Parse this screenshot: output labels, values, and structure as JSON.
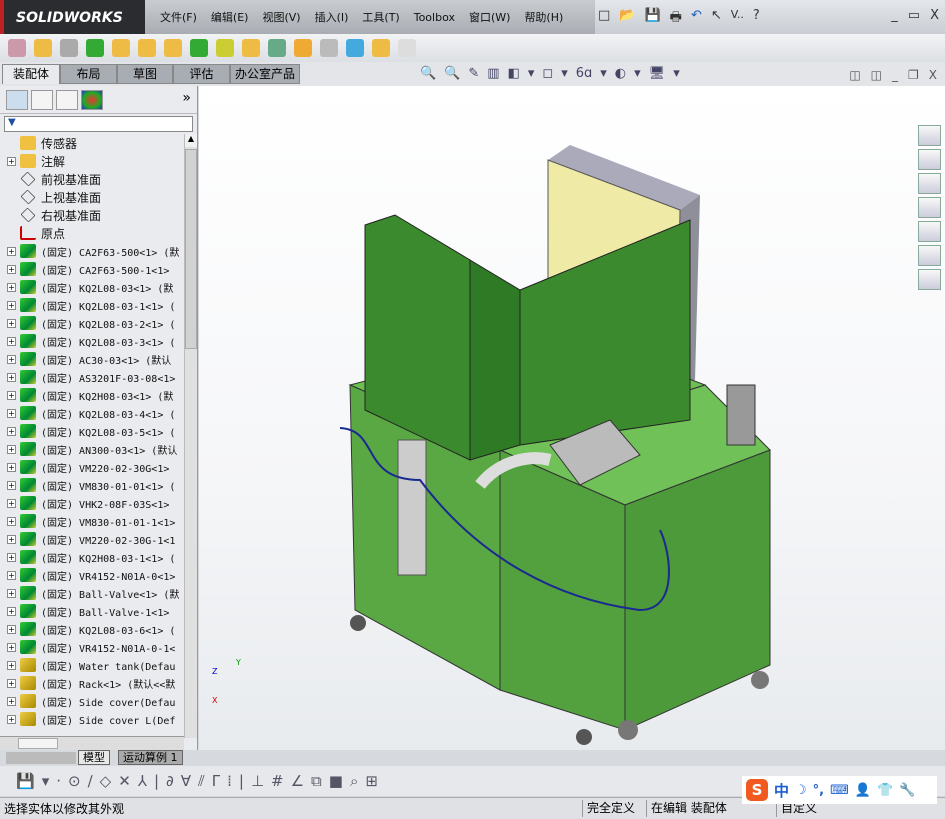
{
  "app": {
    "logo": "SOLIDWORKS"
  },
  "menu": [
    "文件(F)",
    "编辑(E)",
    "视图(V)",
    "插入(I)",
    "工具(T)",
    "Toolbox",
    "窗口(W)",
    "帮助(H)"
  ],
  "quick_access": {
    "new": "□",
    "open": "📂",
    "save": "💾",
    "print": "🖶",
    "undo": "↶",
    "select": "↖",
    "view": "V..",
    "help": "?"
  },
  "window_buttons": {
    "minimize": "_",
    "restore": "▭",
    "close": "X"
  },
  "command_tabs": [
    {
      "label": "装配体",
      "active": true
    },
    {
      "label": "布局"
    },
    {
      "label": "草图"
    },
    {
      "label": "评估"
    },
    {
      "label": "办公室产品"
    }
  ],
  "view_tools": [
    "🔍",
    "🔍",
    "✎",
    "▥",
    "◧",
    "▾",
    "◻",
    "▾",
    "6ɑ",
    "▾",
    "◐",
    "▾",
    "🖥",
    "▾"
  ],
  "viewport_buttons": {
    "tile_left": "◫",
    "tile_right": "◫",
    "minimize": "_",
    "restore": "❐",
    "close": "X"
  },
  "feature_manager": {
    "expand_label": "»",
    "filter": "▼",
    "items": [
      {
        "label": "传感器",
        "icon": "folder-sensor",
        "exp": false,
        "cn": true
      },
      {
        "label": "注解",
        "icon": "folder-annotation",
        "exp": true,
        "cn": true
      },
      {
        "label": "前视基准面",
        "icon": "plane",
        "exp": false,
        "cn": true
      },
      {
        "label": "上视基准面",
        "icon": "plane",
        "exp": false,
        "cn": true
      },
      {
        "label": "右视基准面",
        "icon": "plane",
        "exp": false,
        "cn": true
      },
      {
        "label": "原点",
        "icon": "origin",
        "exp": false,
        "cn": true
      },
      {
        "label": "(固定) CA2F63-500<1> (默",
        "icon": "part-green",
        "exp": true
      },
      {
        "label": "(固定) CA2F63-500-1<1>",
        "icon": "part-green",
        "exp": true
      },
      {
        "label": "(固定) KQ2L08-03<1> (默",
        "icon": "part-green",
        "exp": true
      },
      {
        "label": "(固定) KQ2L08-03-1<1> (",
        "icon": "part-green",
        "exp": true
      },
      {
        "label": "(固定) KQ2L08-03-2<1> (",
        "icon": "part-green",
        "exp": true
      },
      {
        "label": "(固定) KQ2L08-03-3<1> (",
        "icon": "part-green",
        "exp": true
      },
      {
        "label": "(固定) AC30-03<1> (默认",
        "icon": "part-green",
        "exp": true
      },
      {
        "label": "(固定) AS3201F-03-08<1>",
        "icon": "part-green",
        "exp": true
      },
      {
        "label": "(固定) KQ2H08-03<1> (默",
        "icon": "part-green",
        "exp": true
      },
      {
        "label": "(固定) KQ2L08-03-4<1> (",
        "icon": "part-green",
        "exp": true
      },
      {
        "label": "(固定) KQ2L08-03-5<1> (",
        "icon": "part-green",
        "exp": true
      },
      {
        "label": "(固定) AN300-03<1> (默认",
        "icon": "part-green",
        "exp": true
      },
      {
        "label": "(固定) VM220-02-30G<1>",
        "icon": "part-green",
        "exp": true
      },
      {
        "label": "(固定) VM830-01-01<1> (",
        "icon": "part-green",
        "exp": true
      },
      {
        "label": "(固定) VHK2-08F-03S<1>",
        "icon": "part-green",
        "exp": true
      },
      {
        "label": "(固定) VM830-01-01-1<1>",
        "icon": "part-green",
        "exp": true
      },
      {
        "label": "(固定) VM220-02-30G-1<1",
        "icon": "part-green",
        "exp": true
      },
      {
        "label": "(固定) KQ2H08-03-1<1> (",
        "icon": "part-green",
        "exp": true
      },
      {
        "label": "(固定) VR4152-N01A-0<1>",
        "icon": "part-green",
        "exp": true
      },
      {
        "label": "(固定) Ball-Valve<1> (默",
        "icon": "part-green",
        "exp": true
      },
      {
        "label": "(固定) Ball-Valve-1<1>",
        "icon": "part-green",
        "exp": true
      },
      {
        "label": "(固定) KQ2L08-03-6<1> (",
        "icon": "part-green",
        "exp": true
      },
      {
        "label": "(固定) VR4152-N01A-0-1<",
        "icon": "part-green",
        "exp": true
      },
      {
        "label": "(固定) Water tank(Defau",
        "icon": "part-yellow",
        "exp": true
      },
      {
        "label": "(固定) Rack<1> (默认<<默",
        "icon": "part-yellow",
        "exp": true
      },
      {
        "label": "(固定) Side cover(Defau",
        "icon": "part-yellow",
        "exp": true
      },
      {
        "label": "(固定) Side cover L(Def",
        "icon": "part-yellow",
        "exp": true
      }
    ]
  },
  "bottom_tabs": [
    {
      "label": "模型",
      "active": true
    },
    {
      "label": "运动算例 1"
    }
  ],
  "sketch_tools": [
    "💾",
    "▾",
    "·",
    "⊙",
    "∕",
    "◇",
    "✕",
    "⅄",
    "|",
    "∂",
    "∀",
    "⫽",
    "Γ",
    "⁞",
    "|",
    "⊥",
    "#",
    "∠",
    "⧉",
    "■",
    "⌕",
    "⊞"
  ],
  "status": {
    "message": "选择实体以修改其外观",
    "definition": "完全定义",
    "mode": "在编辑 装配体",
    "custom": "自定义"
  },
  "ime": {
    "logo": "S",
    "lang": "中",
    "icons": [
      "☽",
      "°,",
      "⌨",
      "👤",
      "👕",
      "🔧"
    ]
  },
  "triad": {
    "y": "Y",
    "z": "Z",
    "x": "X"
  },
  "colors": {
    "model_green": "#5aa843",
    "cover_green": "#3c8a2e",
    "panel_yellow": "#efeaa6",
    "frame_gray": "#8f8f9a"
  }
}
